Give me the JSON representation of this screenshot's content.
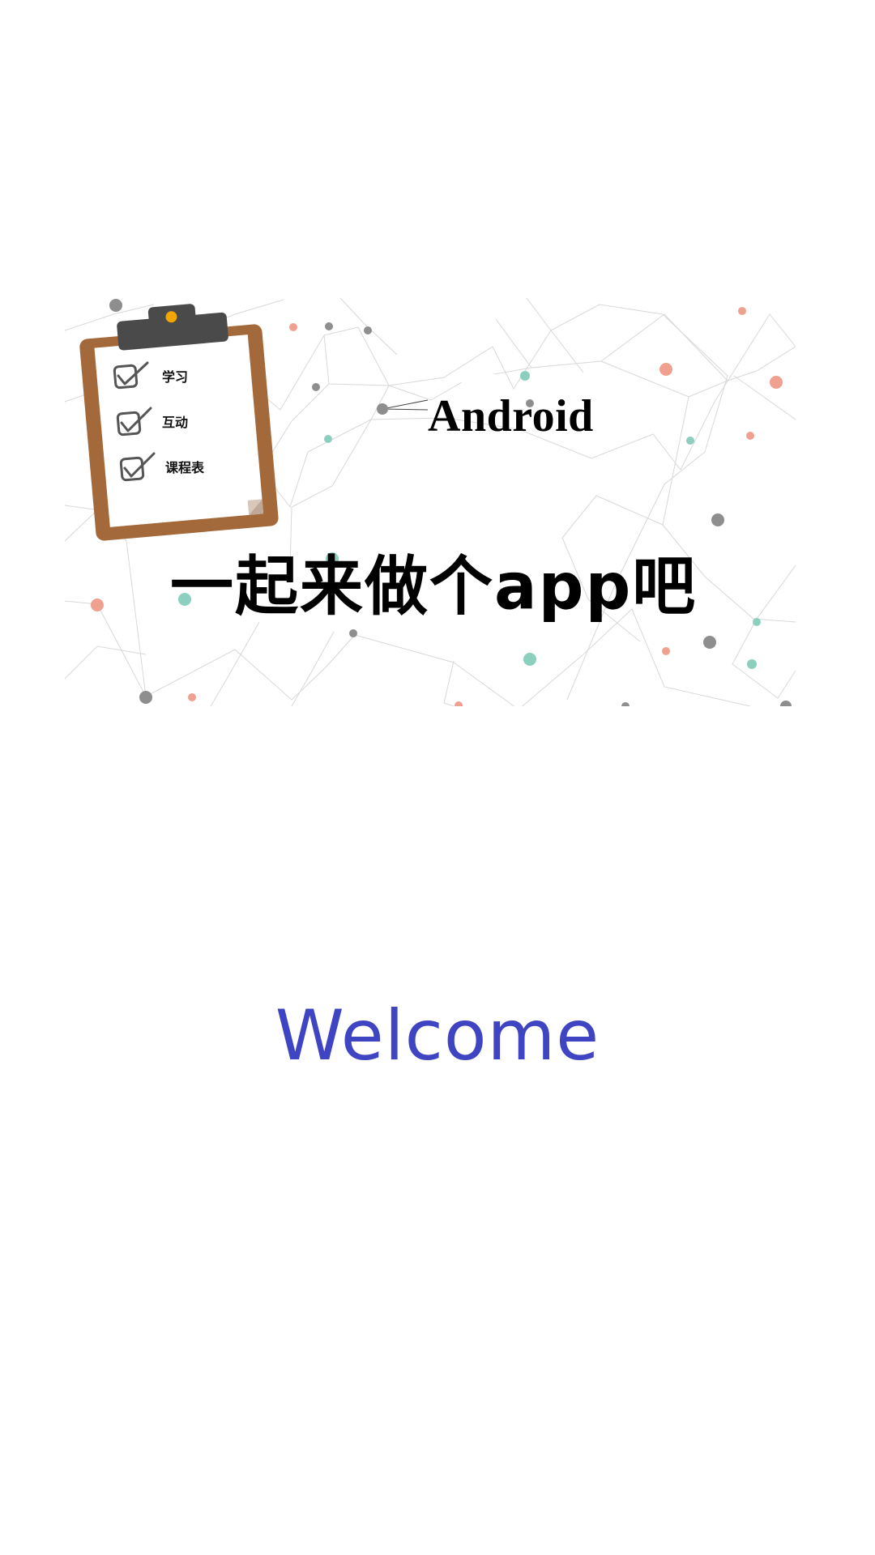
{
  "banner": {
    "title": "Android",
    "slogan": "一起来做个app吧",
    "checklist": [
      {
        "label": "学习"
      },
      {
        "label": "互动"
      },
      {
        "label": "课程表"
      }
    ],
    "colors": {
      "clipboard_frame": "#a3693a",
      "clip": "#4a4a4a",
      "clip_dot": "#f0a500",
      "node_gray": "#8e8e8e",
      "node_teal": "#8ccfbe",
      "node_salmon": "#f0a08e",
      "line": "#d5d5d5"
    }
  },
  "welcome": {
    "text": "Welcome",
    "color": "#3f44c2"
  }
}
